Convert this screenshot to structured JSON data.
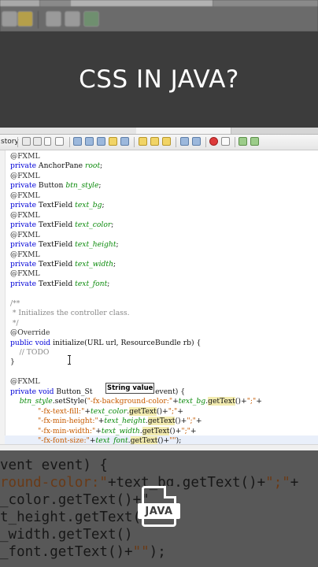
{
  "title": "CSS IN JAVA?",
  "ide": {
    "history_label": "story",
    "tooltip": "String value"
  },
  "code_lines": [
    {
      "parts": [
        {
          "t": "@FXML",
          "c": "ann"
        }
      ]
    },
    {
      "parts": [
        {
          "t": "private",
          "c": "kw"
        },
        {
          "t": " AnchorPane ",
          "c": "ty"
        },
        {
          "t": "root",
          "c": "fld"
        },
        {
          "t": ";",
          "c": "ty"
        }
      ]
    },
    {
      "parts": [
        {
          "t": "@FXML",
          "c": "ann"
        }
      ]
    },
    {
      "parts": [
        {
          "t": "private",
          "c": "kw"
        },
        {
          "t": " Button ",
          "c": "ty"
        },
        {
          "t": "btn_style",
          "c": "fld"
        },
        {
          "t": ";",
          "c": "ty"
        }
      ]
    },
    {
      "parts": [
        {
          "t": "@FXML",
          "c": "ann"
        }
      ]
    },
    {
      "parts": [
        {
          "t": "private",
          "c": "kw"
        },
        {
          "t": " TextField ",
          "c": "ty"
        },
        {
          "t": "text_bg",
          "c": "fld"
        },
        {
          "t": ";",
          "c": "ty"
        }
      ]
    },
    {
      "parts": [
        {
          "t": "@FXML",
          "c": "ann"
        }
      ]
    },
    {
      "parts": [
        {
          "t": "private",
          "c": "kw"
        },
        {
          "t": " TextField ",
          "c": "ty"
        },
        {
          "t": "text_color",
          "c": "fld"
        },
        {
          "t": ";",
          "c": "ty"
        }
      ]
    },
    {
      "parts": [
        {
          "t": "@FXML",
          "c": "ann"
        }
      ]
    },
    {
      "parts": [
        {
          "t": "private",
          "c": "kw"
        },
        {
          "t": " TextField ",
          "c": "ty"
        },
        {
          "t": "text_height",
          "c": "fld"
        },
        {
          "t": ";",
          "c": "ty"
        }
      ]
    },
    {
      "parts": [
        {
          "t": "@FXML",
          "c": "ann"
        }
      ]
    },
    {
      "parts": [
        {
          "t": "private",
          "c": "kw"
        },
        {
          "t": " TextField ",
          "c": "ty"
        },
        {
          "t": "text_width",
          "c": "fld"
        },
        {
          "t": ";",
          "c": "ty"
        }
      ]
    },
    {
      "parts": [
        {
          "t": "@FXML",
          "c": "ann"
        }
      ]
    },
    {
      "parts": [
        {
          "t": "private",
          "c": "kw"
        },
        {
          "t": " TextField ",
          "c": "ty"
        },
        {
          "t": "text_font",
          "c": "fld"
        },
        {
          "t": ";",
          "c": "ty"
        }
      ]
    },
    {
      "parts": []
    },
    {
      "parts": [
        {
          "t": "/**",
          "c": "cmt"
        }
      ]
    },
    {
      "parts": [
        {
          "t": " * Initializes the controller class.",
          "c": "cmt"
        }
      ]
    },
    {
      "parts": [
        {
          "t": " */",
          "c": "cmt"
        }
      ]
    },
    {
      "parts": [
        {
          "t": "@Override",
          "c": "ann"
        }
      ]
    },
    {
      "parts": [
        {
          "t": "public",
          "c": "kw"
        },
        {
          "t": " ",
          "c": "ty"
        },
        {
          "t": "void",
          "c": "kw"
        },
        {
          "t": " initialize(URL url, ResourceBundle rb) {",
          "c": "ty"
        }
      ]
    },
    {
      "parts": [
        {
          "t": "    // TODO",
          "c": "cmt"
        }
      ]
    },
    {
      "parts": [
        {
          "t": "}",
          "c": "ty"
        }
      ]
    },
    {
      "parts": []
    },
    {
      "parts": [
        {
          "t": "@FXML",
          "c": "ann"
        }
      ]
    },
    {
      "parts": [
        {
          "t": "private",
          "c": "kw"
        },
        {
          "t": " ",
          "c": "ty"
        },
        {
          "t": "void",
          "c": "kw"
        },
        {
          "t": " Button_St",
          "c": "ty"
        },
        {
          "t": "               ",
          "c": "ty"
        },
        {
          "t": "nEvent event) {",
          "c": "ty"
        }
      ]
    },
    {
      "parts": [
        {
          "t": "    ",
          "c": "ty"
        },
        {
          "t": "btn_style",
          "c": "fld"
        },
        {
          "t": ".setStyle(",
          "c": "ty"
        },
        {
          "t": "\"-fx-background-color:\"",
          "c": "str"
        },
        {
          "t": "+",
          "c": "ty"
        },
        {
          "t": "text_bg",
          "c": "fld"
        },
        {
          "t": ".",
          "c": "ty"
        },
        {
          "t": "getText",
          "c": "mth"
        },
        {
          "t": "()+",
          "c": "ty"
        },
        {
          "t": "\";\"",
          "c": "str"
        },
        {
          "t": "+",
          "c": "ty"
        }
      ]
    },
    {
      "parts": [
        {
          "t": "            ",
          "c": "ty"
        },
        {
          "t": "\"-fx-text-fill:\"",
          "c": "str"
        },
        {
          "t": "+",
          "c": "ty"
        },
        {
          "t": "text_color",
          "c": "fld"
        },
        {
          "t": ".",
          "c": "ty"
        },
        {
          "t": "getText",
          "c": "mth"
        },
        {
          "t": "()+",
          "c": "ty"
        },
        {
          "t": "\";\"",
          "c": "str"
        },
        {
          "t": "+",
          "c": "ty"
        }
      ]
    },
    {
      "parts": [
        {
          "t": "            ",
          "c": "ty"
        },
        {
          "t": "\"-fx-min-height:\"",
          "c": "str"
        },
        {
          "t": "+",
          "c": "ty"
        },
        {
          "t": "text_height",
          "c": "fld"
        },
        {
          "t": ".",
          "c": "ty"
        },
        {
          "t": "getText",
          "c": "mth"
        },
        {
          "t": "()+",
          "c": "ty"
        },
        {
          "t": "\";\"",
          "c": "str"
        },
        {
          "t": "+",
          "c": "ty"
        }
      ]
    },
    {
      "parts": [
        {
          "t": "            ",
          "c": "ty"
        },
        {
          "t": "\"-fx-min-width:\"",
          "c": "str"
        },
        {
          "t": "+",
          "c": "ty"
        },
        {
          "t": "text_width",
          "c": "fld"
        },
        {
          "t": ".",
          "c": "ty"
        },
        {
          "t": "getText",
          "c": "mth"
        },
        {
          "t": "()+",
          "c": "ty"
        },
        {
          "t": "\";\"",
          "c": "str"
        },
        {
          "t": "+",
          "c": "ty"
        }
      ]
    },
    {
      "parts": [
        {
          "t": "            ",
          "c": "ty"
        },
        {
          "t": "\"-fx-font-size:\"",
          "c": "str"
        },
        {
          "t": "+",
          "c": "ty"
        },
        {
          "t": "text_font",
          "c": "fld"
        },
        {
          "t": ".",
          "c": "ty"
        },
        {
          "t": "getText",
          "c": "mth"
        },
        {
          "t": "()+",
          "c": "ty"
        },
        {
          "t": "\"\"",
          "c": "str"
        },
        {
          "t": ");",
          "c": "ty"
        }
      ]
    }
  ],
  "zoom_lines": [
    {
      "parts": [
        {
          "t": "vent event) {",
          "c": "z"
        }
      ]
    },
    {
      "parts": [
        {
          "t": "round-color:\"",
          "c": "zstr"
        },
        {
          "t": "+text_bg.getText()+",
          "c": "z"
        },
        {
          "t": "\";\"",
          "c": "zstr"
        },
        {
          "t": "+",
          "c": "z"
        }
      ]
    },
    {
      "parts": [
        {
          "t": "_color.getText()+\"",
          "c": "z"
        }
      ]
    },
    {
      "parts": [
        {
          "t": "t_height.getText(",
          "c": "z"
        }
      ]
    },
    {
      "parts": [
        {
          "t": "_width.getText()",
          "c": "z"
        }
      ]
    },
    {
      "parts": [
        {
          "t": "_font.getText()+",
          "c": "z"
        },
        {
          "t": "\"\"",
          "c": "zstr"
        },
        {
          "t": ");",
          "c": "z"
        }
      ]
    }
  ],
  "java_label": "JAVA",
  "icons": [
    "history-icon",
    "find-icon",
    "replace-icon",
    "bookmark-icon",
    "run-icon",
    "stop-icon",
    "checkbox-icon",
    "java-file-icon"
  ]
}
